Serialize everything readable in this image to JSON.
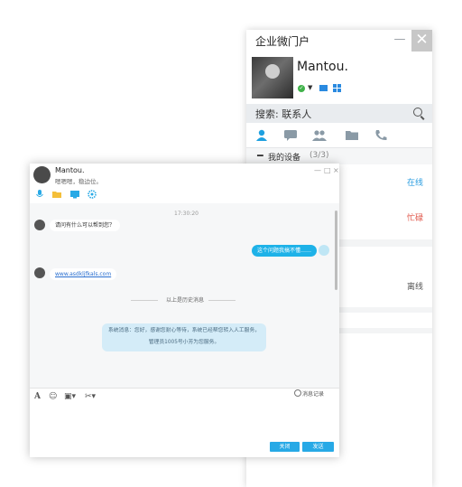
{
  "portal": {
    "title": "企业微门户",
    "minimize": "—",
    "close": "✕",
    "username": "Mantou.",
    "search_label": "搜索: 联系人",
    "group": {
      "title": "我的设备",
      "count": "(3/3)"
    },
    "device_states": [
      "在线",
      "忙碌",
      "离线"
    ],
    "colors": {
      "online": "#2a9de0",
      "busy": "#e0564a",
      "offline": "#555555"
    }
  },
  "chat": {
    "name": "Mantou.",
    "signature": "嗯嗯嗯，稳边位。",
    "window_controls": [
      "—",
      "□",
      "×"
    ],
    "time": "17:30:20",
    "messages": {
      "in_1": "请问有什么可以帮到您？",
      "out_1": "这个问题我搞不懂……",
      "link": "www.asdkljfkals.com"
    },
    "history_divider": "以上是历史消息",
    "system_line1": "系统消息：您好，感谢您耐心等待，系统已经帮您转入人工服务，",
    "system_line2": "管理员1005号小芳为您服务。",
    "history_link": "消息记录",
    "close_button": "关闭",
    "send_button": "发送"
  }
}
